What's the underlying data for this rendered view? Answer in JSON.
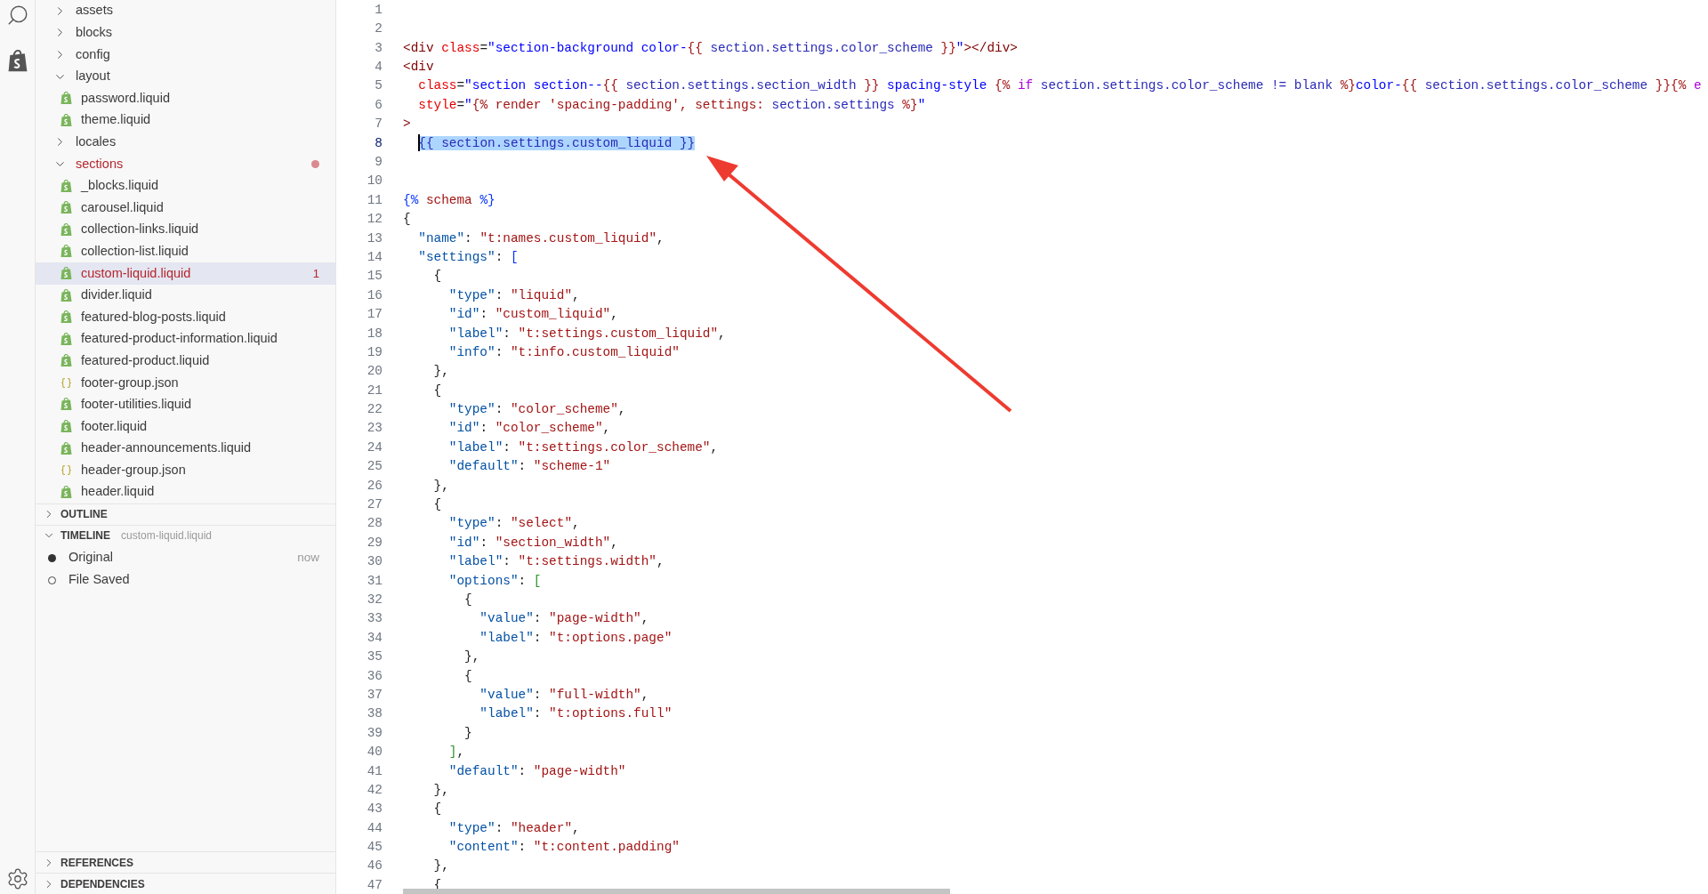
{
  "explorer": {
    "tree": [
      {
        "label": "assets",
        "kind": "folder",
        "expanded": false,
        "selected": false,
        "problem": false
      },
      {
        "label": "blocks",
        "kind": "folder",
        "expanded": false,
        "selected": false,
        "problem": false
      },
      {
        "label": "config",
        "kind": "folder",
        "expanded": false,
        "selected": false,
        "problem": false
      },
      {
        "label": "layout",
        "kind": "folder",
        "expanded": true,
        "selected": false,
        "problem": false,
        "children": [
          {
            "label": "password.liquid",
            "kind": "liquid",
            "selected": false,
            "problem": false
          },
          {
            "label": "theme.liquid",
            "kind": "liquid",
            "selected": false,
            "problem": false
          }
        ]
      },
      {
        "label": "locales",
        "kind": "folder",
        "expanded": false,
        "selected": false,
        "problem": false
      },
      {
        "label": "sections",
        "kind": "folder",
        "expanded": true,
        "selected": false,
        "problem": true,
        "children": [
          {
            "label": "_blocks.liquid",
            "kind": "liquid",
            "selected": false,
            "problem": false
          },
          {
            "label": "carousel.liquid",
            "kind": "liquid",
            "selected": false,
            "problem": false
          },
          {
            "label": "collection-links.liquid",
            "kind": "liquid",
            "selected": false,
            "problem": false
          },
          {
            "label": "collection-list.liquid",
            "kind": "liquid",
            "selected": false,
            "problem": false
          },
          {
            "label": "custom-liquid.liquid",
            "kind": "liquid",
            "selected": true,
            "problem": true,
            "badge": "1"
          },
          {
            "label": "divider.liquid",
            "kind": "liquid",
            "selected": false,
            "problem": false
          },
          {
            "label": "featured-blog-posts.liquid",
            "kind": "liquid",
            "selected": false,
            "problem": false
          },
          {
            "label": "featured-product-information.liquid",
            "kind": "liquid",
            "selected": false,
            "problem": false
          },
          {
            "label": "featured-product.liquid",
            "kind": "liquid",
            "selected": false,
            "problem": false
          },
          {
            "label": "footer-group.json",
            "kind": "json",
            "selected": false,
            "problem": false
          },
          {
            "label": "footer-utilities.liquid",
            "kind": "liquid",
            "selected": false,
            "problem": false
          },
          {
            "label": "footer.liquid",
            "kind": "liquid",
            "selected": false,
            "problem": false
          },
          {
            "label": "header-announcements.liquid",
            "kind": "liquid",
            "selected": false,
            "problem": false
          },
          {
            "label": "header-group.json",
            "kind": "json",
            "selected": false,
            "problem": false
          },
          {
            "label": "header.liquid",
            "kind": "liquid",
            "selected": false,
            "problem": false
          }
        ]
      }
    ]
  },
  "panels": [
    {
      "title": "OUTLINE",
      "expanded": false
    },
    {
      "title": "TIMELINE",
      "expanded": true,
      "subtitle": "custom-liquid.liquid",
      "entries": [
        {
          "label": "Original",
          "current": true,
          "time": "now"
        },
        {
          "label": "File Saved",
          "current": false
        }
      ]
    },
    {
      "title": "REFERENCES",
      "expanded": false
    },
    {
      "title": "DEPENDENCIES",
      "expanded": false
    }
  ],
  "editor": {
    "lines": [
      {
        "number": "1",
        "selected": false
      },
      {
        "number": "2",
        "selected": false
      },
      {
        "number": "3",
        "selected": false,
        "segments": [
          {
            "text": "<div",
            "kind": "tag"
          },
          {
            "text": " class",
            "kind": "attr"
          },
          {
            "text": "=",
            "kind": "punct"
          },
          {
            "text": "\"section-background color-",
            "kind": "str"
          },
          {
            "text": "{{",
            "kind": "delim"
          },
          {
            "text": " section.settings.color_scheme ",
            "kind": "var"
          },
          {
            "text": "}}",
            "kind": "delim"
          },
          {
            "text": "\"",
            "kind": "str"
          },
          {
            "text": "></div>",
            "kind": "tag"
          }
        ]
      },
      {
        "number": "4",
        "selected": false,
        "segments": [
          {
            "text": "<div",
            "kind": "tag"
          }
        ]
      },
      {
        "number": "5",
        "selected": false,
        "segments": [
          {
            "text": "  class",
            "kind": "attr"
          },
          {
            "text": "=",
            "kind": "punct"
          },
          {
            "text": "\"section section--",
            "kind": "str"
          },
          {
            "text": "{{",
            "kind": "delim"
          },
          {
            "text": " section.settings.section_width ",
            "kind": "var"
          },
          {
            "text": "}}",
            "kind": "delim"
          },
          {
            "text": " spacing-style ",
            "kind": "str"
          },
          {
            "text": "{%",
            "kind": "delim"
          },
          {
            "text": " if",
            "kind": "kw"
          },
          {
            "text": " section.settings.color_scheme != blank ",
            "kind": "var"
          },
          {
            "text": "%}",
            "kind": "delim"
          },
          {
            "text": "color-",
            "kind": "str"
          },
          {
            "text": "{{",
            "kind": "delim"
          },
          {
            "text": " section.settings.color_scheme ",
            "kind": "var"
          },
          {
            "text": "}}{%",
            "kind": "delim"
          },
          {
            "text": " e",
            "kind": "kw"
          }
        ]
      },
      {
        "number": "6",
        "selected": false,
        "segments": [
          {
            "text": "  style",
            "kind": "attr"
          },
          {
            "text": "=",
            "kind": "punct"
          },
          {
            "text": "\"",
            "kind": "str"
          },
          {
            "text": "{% render 'spacing-padding', settings: ",
            "kind": "delim"
          },
          {
            "text": "section.settings",
            "kind": "var"
          },
          {
            "text": " %}",
            "kind": "delim"
          },
          {
            "text": "\"",
            "kind": "str"
          }
        ]
      },
      {
        "number": "7",
        "selected": false,
        "segments": [
          {
            "text": ">",
            "kind": "tag"
          }
        ]
      },
      {
        "number": "8",
        "selected": true,
        "segments": [
          {
            "text": "  {{",
            "kind": "var"
          },
          {
            "text": " section.settings.custom_liquid ",
            "kind": "var"
          },
          {
            "text": "}}",
            "kind": "var"
          }
        ]
      },
      {
        "number": "9",
        "selected": false
      },
      {
        "number": "10",
        "selected": false
      },
      {
        "number": "11",
        "selected": false,
        "segments": [
          {
            "text": "{%",
            "kind": "bracket"
          },
          {
            "text": " schema ",
            "kind": "delim"
          },
          {
            "text": "%}",
            "kind": "bracket"
          }
        ]
      },
      {
        "number": "12",
        "selected": false,
        "segments": [
          {
            "text": "{",
            "kind": "punct"
          }
        ]
      },
      {
        "number": "13",
        "selected": false,
        "segments": [
          {
            "text": "  \"name\"",
            "kind": "key"
          },
          {
            "text": ": ",
            "kind": "punct"
          },
          {
            "text": "\"t:names.custom_liquid\"",
            "kind": "val"
          },
          {
            "text": ",",
            "kind": "punct"
          }
        ]
      },
      {
        "number": "14",
        "selected": false,
        "segments": [
          {
            "text": "  \"settings\"",
            "kind": "key"
          },
          {
            "text": ": ",
            "kind": "punct"
          },
          {
            "text": "[",
            "kind": "bracket"
          }
        ]
      },
      {
        "number": "15",
        "selected": false,
        "segments": [
          {
            "text": "    {",
            "kind": "punct"
          }
        ]
      },
      {
        "number": "16",
        "selected": false,
        "segments": [
          {
            "text": "      \"type\"",
            "kind": "key"
          },
          {
            "text": ": ",
            "kind": "punct"
          },
          {
            "text": "\"liquid\"",
            "kind": "val"
          },
          {
            "text": ",",
            "kind": "punct"
          }
        ]
      },
      {
        "number": "17",
        "selected": false,
        "segments": [
          {
            "text": "      \"id\"",
            "kind": "key"
          },
          {
            "text": ": ",
            "kind": "punct"
          },
          {
            "text": "\"custom_liquid\"",
            "kind": "val"
          },
          {
            "text": ",",
            "kind": "punct"
          }
        ]
      },
      {
        "number": "18",
        "selected": false,
        "segments": [
          {
            "text": "      \"label\"",
            "kind": "key"
          },
          {
            "text": ": ",
            "kind": "punct"
          },
          {
            "text": "\"t:settings.custom_liquid\"",
            "kind": "val"
          },
          {
            "text": ",",
            "kind": "punct"
          }
        ]
      },
      {
        "number": "19",
        "selected": false,
        "segments": [
          {
            "text": "      \"info\"",
            "kind": "key"
          },
          {
            "text": ": ",
            "kind": "punct"
          },
          {
            "text": "\"t:info.custom_liquid\"",
            "kind": "val"
          }
        ]
      },
      {
        "number": "20",
        "selected": false,
        "segments": [
          {
            "text": "    },",
            "kind": "punct"
          }
        ]
      },
      {
        "number": "21",
        "selected": false,
        "segments": [
          {
            "text": "    {",
            "kind": "punct"
          }
        ]
      },
      {
        "number": "22",
        "selected": false,
        "segments": [
          {
            "text": "      \"type\"",
            "kind": "key"
          },
          {
            "text": ": ",
            "kind": "punct"
          },
          {
            "text": "\"color_scheme\"",
            "kind": "val"
          },
          {
            "text": ",",
            "kind": "punct"
          }
        ]
      },
      {
        "number": "23",
        "selected": false,
        "segments": [
          {
            "text": "      \"id\"",
            "kind": "key"
          },
          {
            "text": ": ",
            "kind": "punct"
          },
          {
            "text": "\"color_scheme\"",
            "kind": "val"
          },
          {
            "text": ",",
            "kind": "punct"
          }
        ]
      },
      {
        "number": "24",
        "selected": false,
        "segments": [
          {
            "text": "      \"label\"",
            "kind": "key"
          },
          {
            "text": ": ",
            "kind": "punct"
          },
          {
            "text": "\"t:settings.color_scheme\"",
            "kind": "val"
          },
          {
            "text": ",",
            "kind": "punct"
          }
        ]
      },
      {
        "number": "25",
        "selected": false,
        "segments": [
          {
            "text": "      \"default\"",
            "kind": "key"
          },
          {
            "text": ": ",
            "kind": "punct"
          },
          {
            "text": "\"scheme-1\"",
            "kind": "val"
          }
        ]
      },
      {
        "number": "26",
        "selected": false,
        "segments": [
          {
            "text": "    },",
            "kind": "punct"
          }
        ]
      },
      {
        "number": "27",
        "selected": false,
        "segments": [
          {
            "text": "    {",
            "kind": "punct"
          }
        ]
      },
      {
        "number": "28",
        "selected": false,
        "segments": [
          {
            "text": "      \"type\"",
            "kind": "key"
          },
          {
            "text": ": ",
            "kind": "punct"
          },
          {
            "text": "\"select\"",
            "kind": "val"
          },
          {
            "text": ",",
            "kind": "punct"
          }
        ]
      },
      {
        "number": "29",
        "selected": false,
        "segments": [
          {
            "text": "      \"id\"",
            "kind": "key"
          },
          {
            "text": ": ",
            "kind": "punct"
          },
          {
            "text": "\"section_width\"",
            "kind": "val"
          },
          {
            "text": ",",
            "kind": "punct"
          }
        ]
      },
      {
        "number": "30",
        "selected": false,
        "segments": [
          {
            "text": "      \"label\"",
            "kind": "key"
          },
          {
            "text": ": ",
            "kind": "punct"
          },
          {
            "text": "\"t:settings.width\"",
            "kind": "val"
          },
          {
            "text": ",",
            "kind": "punct"
          }
        ]
      },
      {
        "number": "31",
        "selected": false,
        "segments": [
          {
            "text": "      \"options\"",
            "kind": "key"
          },
          {
            "text": ": ",
            "kind": "punct"
          },
          {
            "text": "[",
            "kind": "bracket2"
          }
        ]
      },
      {
        "number": "32",
        "selected": false,
        "segments": [
          {
            "text": "        {",
            "kind": "punct"
          }
        ]
      },
      {
        "number": "33",
        "selected": false,
        "segments": [
          {
            "text": "          \"value\"",
            "kind": "key"
          },
          {
            "text": ": ",
            "kind": "punct"
          },
          {
            "text": "\"page-width\"",
            "kind": "val"
          },
          {
            "text": ",",
            "kind": "punct"
          }
        ]
      },
      {
        "number": "34",
        "selected": false,
        "segments": [
          {
            "text": "          \"label\"",
            "kind": "key"
          },
          {
            "text": ": ",
            "kind": "punct"
          },
          {
            "text": "\"t:options.page\"",
            "kind": "val"
          }
        ]
      },
      {
        "number": "35",
        "selected": false,
        "segments": [
          {
            "text": "        },",
            "kind": "punct"
          }
        ]
      },
      {
        "number": "36",
        "selected": false,
        "segments": [
          {
            "text": "        {",
            "kind": "punct"
          }
        ]
      },
      {
        "number": "37",
        "selected": false,
        "segments": [
          {
            "text": "          \"value\"",
            "kind": "key"
          },
          {
            "text": ": ",
            "kind": "punct"
          },
          {
            "text": "\"full-width\"",
            "kind": "val"
          },
          {
            "text": ",",
            "kind": "punct"
          }
        ]
      },
      {
        "number": "38",
        "selected": false,
        "segments": [
          {
            "text": "          \"label\"",
            "kind": "key"
          },
          {
            "text": ": ",
            "kind": "punct"
          },
          {
            "text": "\"t:options.full\"",
            "kind": "val"
          }
        ]
      },
      {
        "number": "39",
        "selected": false,
        "segments": [
          {
            "text": "        }",
            "kind": "punct"
          }
        ]
      },
      {
        "number": "40",
        "selected": false,
        "segments": [
          {
            "text": "      ]",
            "kind": "bracket2"
          },
          {
            "text": ",",
            "kind": "punct"
          }
        ]
      },
      {
        "number": "41",
        "selected": false,
        "segments": [
          {
            "text": "      \"default\"",
            "kind": "key"
          },
          {
            "text": ": ",
            "kind": "punct"
          },
          {
            "text": "\"page-width\"",
            "kind": "val"
          }
        ]
      },
      {
        "number": "42",
        "selected": false,
        "segments": [
          {
            "text": "    },",
            "kind": "punct"
          }
        ]
      },
      {
        "number": "43",
        "selected": false,
        "segments": [
          {
            "text": "    {",
            "kind": "punct"
          }
        ]
      },
      {
        "number": "44",
        "selected": false,
        "segments": [
          {
            "text": "      \"type\"",
            "kind": "key"
          },
          {
            "text": ": ",
            "kind": "punct"
          },
          {
            "text": "\"header\"",
            "kind": "val"
          },
          {
            "text": ",",
            "kind": "punct"
          }
        ]
      },
      {
        "number": "45",
        "selected": false,
        "segments": [
          {
            "text": "      \"content\"",
            "kind": "key"
          },
          {
            "text": ": ",
            "kind": "punct"
          },
          {
            "text": "\"t:content.padding\"",
            "kind": "val"
          }
        ]
      },
      {
        "number": "46",
        "selected": false,
        "segments": [
          {
            "text": "    },",
            "kind": "punct"
          }
        ]
      },
      {
        "number": "47",
        "selected": false,
        "segments": [
          {
            "text": "    {",
            "kind": "punct"
          }
        ]
      }
    ]
  }
}
